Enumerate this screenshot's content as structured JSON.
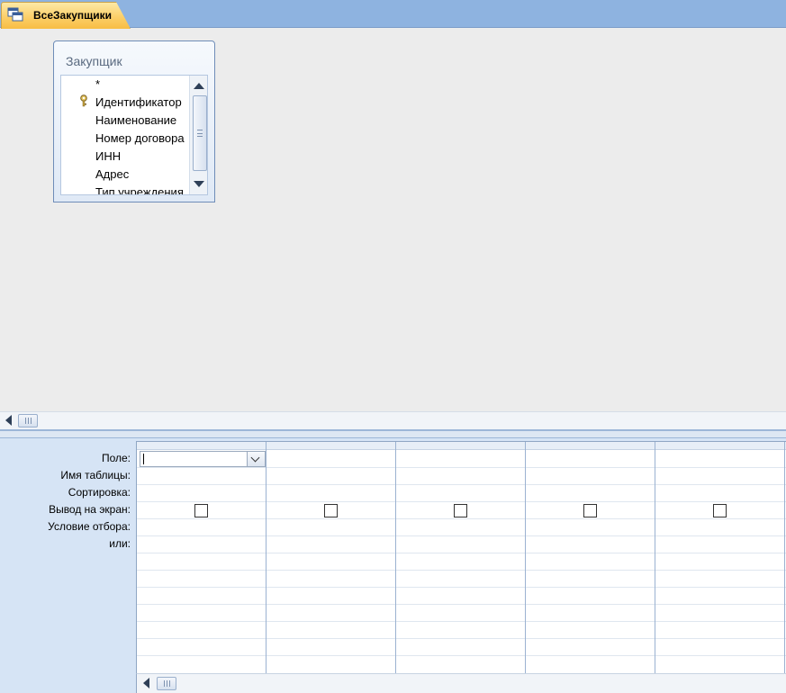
{
  "tab": {
    "title": "ВсеЗакупщики",
    "icon": "query-icon"
  },
  "table_window": {
    "title": "Закупщик",
    "fields": [
      {
        "name": "*",
        "key": false
      },
      {
        "name": "Идентификатор",
        "key": true
      },
      {
        "name": "Наименование",
        "key": false
      },
      {
        "name": "Номер договора",
        "key": false
      },
      {
        "name": "ИНН",
        "key": false
      },
      {
        "name": "Адрес",
        "key": false
      },
      {
        "name": "Тип учреждения",
        "key": false
      }
    ]
  },
  "qbe": {
    "row_labels": {
      "field": "Поле:",
      "table": "Имя таблицы:",
      "sort": "Сортировка:",
      "show": "Вывод на экран:",
      "criteria": "Условие отбора:",
      "or": "или:"
    },
    "columns": [
      {
        "field": "",
        "table": "",
        "sort": "",
        "show": false
      },
      {
        "field": "",
        "table": "",
        "sort": "",
        "show": false
      },
      {
        "field": "",
        "table": "",
        "sort": "",
        "show": false
      },
      {
        "field": "",
        "table": "",
        "sort": "",
        "show": false
      },
      {
        "field": "",
        "table": "",
        "sort": "",
        "show": false
      }
    ]
  },
  "colors": {
    "tab_accent": "#fbcd64",
    "tab_strip": "#8eb3e0",
    "qbe_background": "#d6e4f5"
  }
}
